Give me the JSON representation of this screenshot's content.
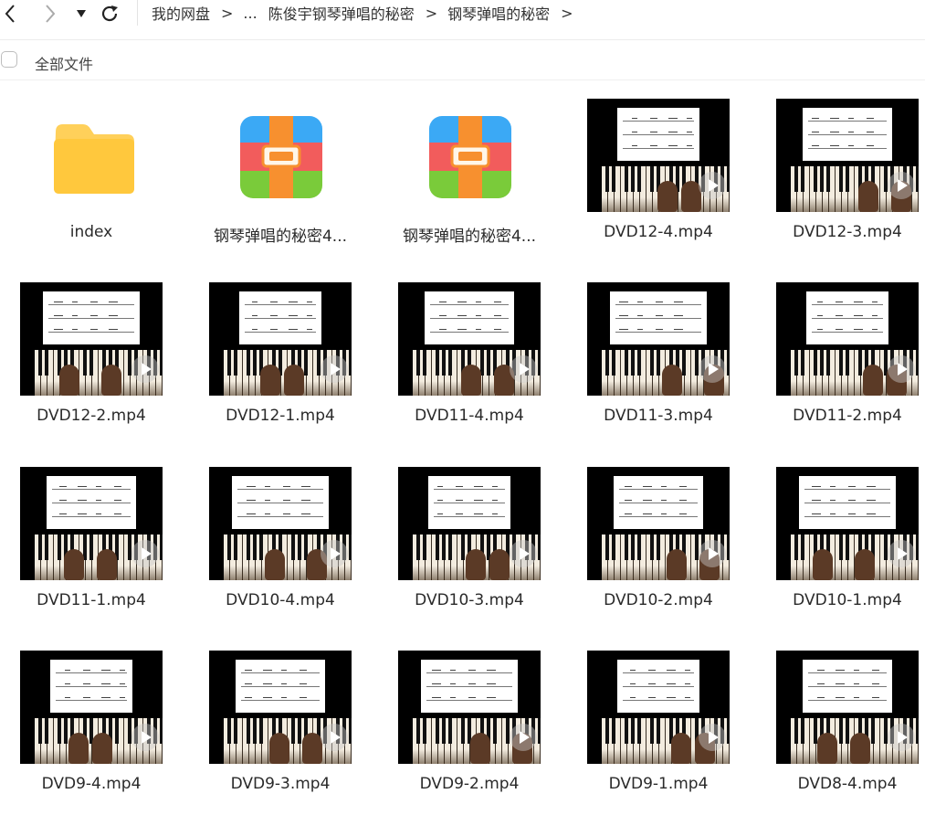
{
  "toolbar": {
    "back_icon": "chevron-left-icon",
    "forward_icon": "chevron-right-icon",
    "dropdown_icon": "triangle-down-icon",
    "refresh_icon": "refresh-icon",
    "breadcrumb": {
      "root": "我的网盘",
      "ellipsis": "...",
      "level1": "陈俊宇钢琴弹唱的秘密",
      "level2": "钢琴弹唱的秘密",
      "separator": ">"
    }
  },
  "subbar": {
    "select_all_label": "全部文件"
  },
  "files": [
    {
      "name": "index",
      "type": "folder"
    },
    {
      "name": "钢琴弹唱的秘密4...",
      "type": "archive"
    },
    {
      "name": "钢琴弹唱的秘密4...",
      "type": "archive"
    },
    {
      "name": "DVD12-4.mp4",
      "type": "video"
    },
    {
      "name": "DVD12-3.mp4",
      "type": "video"
    },
    {
      "name": "DVD12-2.mp4",
      "type": "video"
    },
    {
      "name": "DVD12-1.mp4",
      "type": "video"
    },
    {
      "name": "DVD11-4.mp4",
      "type": "video"
    },
    {
      "name": "DVD11-3.mp4",
      "type": "video"
    },
    {
      "name": "DVD11-2.mp4",
      "type": "video"
    },
    {
      "name": "DVD11-1.mp4",
      "type": "video"
    },
    {
      "name": "DVD10-4.mp4",
      "type": "video"
    },
    {
      "name": "DVD10-3.mp4",
      "type": "video"
    },
    {
      "name": "DVD10-2.mp4",
      "type": "video"
    },
    {
      "name": "DVD10-1.mp4",
      "type": "video"
    },
    {
      "name": "DVD9-4.mp4",
      "type": "video"
    },
    {
      "name": "DVD9-3.mp4",
      "type": "video"
    },
    {
      "name": "DVD9-2.mp4",
      "type": "video"
    },
    {
      "name": "DVD9-1.mp4",
      "type": "video"
    },
    {
      "name": "DVD8-4.mp4",
      "type": "video"
    }
  ],
  "colors": {
    "folder_yellow": "#FFC83D",
    "zip_red": "#F25C5C",
    "zip_blue": "#3BA9F5",
    "zip_green": "#7ACB3A",
    "zip_orange": "#F7902F"
  }
}
